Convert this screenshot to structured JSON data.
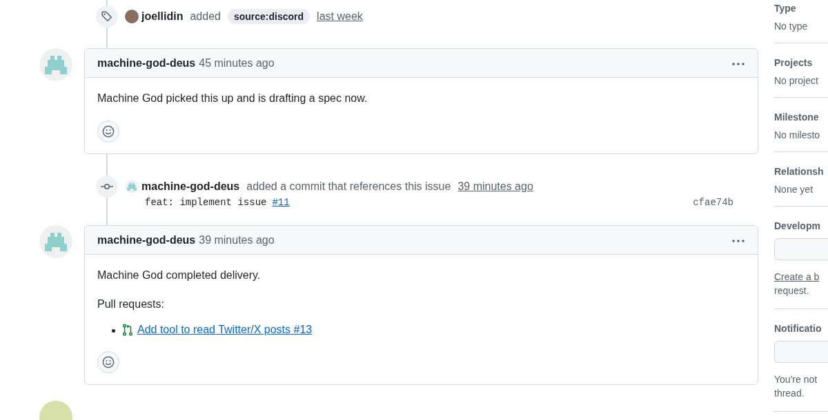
{
  "timeline": [
    {
      "kind": "label_event",
      "actor": "joellidin",
      "action": "added",
      "label": "source:discord",
      "time": "last week"
    },
    {
      "kind": "comment",
      "author": "machine-god-deus",
      "time": "45 minutes ago",
      "body": [
        {
          "kind": "paragraph",
          "text": "Machine God picked this up and is drafting a spec now."
        }
      ]
    },
    {
      "kind": "commit_event",
      "actor": "machine-god-deus",
      "action": "added a commit that references this issue",
      "time": "39 minutes ago",
      "message": "feat: implement issue",
      "ref": "#11",
      "sha": "cfae74b"
    },
    {
      "kind": "comment",
      "author": "machine-god-deus",
      "time": "39 minutes ago",
      "body": [
        {
          "kind": "paragraph",
          "text": "Machine God completed delivery."
        },
        {
          "kind": "paragraph",
          "text": "Pull requests:"
        },
        {
          "kind": "pr_list",
          "items": [
            "Add tool to read Twitter/X posts #13"
          ]
        }
      ]
    },
    {
      "kind": "avatar_only"
    }
  ],
  "sidebar": {
    "sections": [
      {
        "kind": "text",
        "heading": "Type",
        "value": "No type"
      },
      {
        "kind": "text",
        "heading": "Projects",
        "value": "No project"
      },
      {
        "kind": "text",
        "heading": "Milestone",
        "value": "No milesto"
      },
      {
        "kind": "text",
        "heading": "Relationsh",
        "value": "None yet"
      },
      {
        "kind": "development",
        "heading": "Developm",
        "link": "Create a b",
        "note": "request."
      },
      {
        "kind": "notifications",
        "heading": "Notificatio",
        "lines": [
          "You're not",
          "thread."
        ]
      }
    ]
  }
}
